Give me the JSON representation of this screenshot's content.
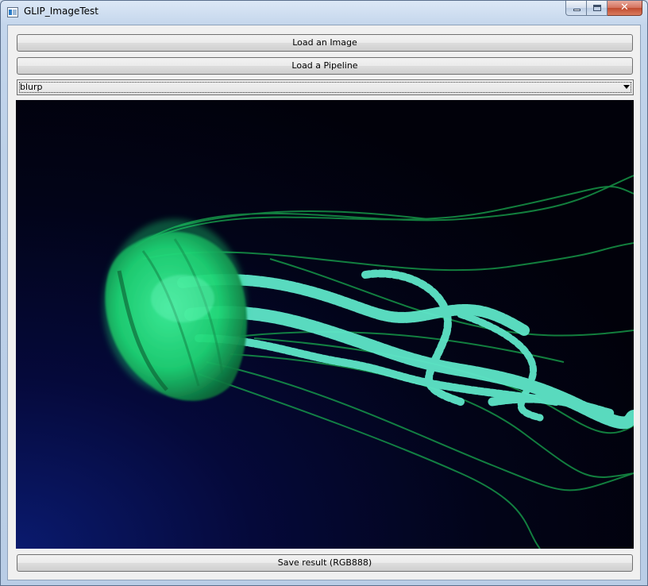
{
  "window": {
    "title": "GLIP_ImageTest",
    "close_glyph": "✕"
  },
  "buttons": {
    "load_image": "Load an Image",
    "load_pipeline": "Load a Pipeline",
    "save_result": "Save result (RGB888)"
  },
  "pipeline_select": {
    "selected": "blurp"
  },
  "image": {
    "subject": "jellyfish",
    "colors": {
      "background_dark": "#02020f",
      "background_corner_blue": "#0a1a6e",
      "jellyfish_green": "#1fe07a",
      "tentacle_cyan": "#5ee6c8"
    }
  }
}
